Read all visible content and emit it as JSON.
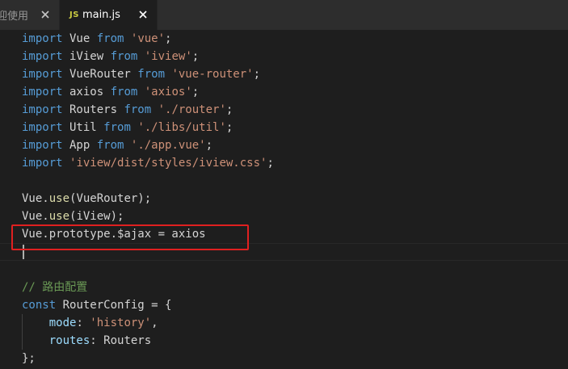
{
  "tabs": [
    {
      "label": "迎使用",
      "active": false
    },
    {
      "label": "main.js",
      "icon": "JS",
      "active": true
    }
  ],
  "code_lines": [
    [
      [
        "kw",
        "import"
      ],
      [
        "id",
        " Vue "
      ],
      [
        "kw",
        "from"
      ],
      [
        "id",
        " "
      ],
      [
        "str",
        "'vue'"
      ],
      [
        "pn",
        ";"
      ]
    ],
    [
      [
        "kw",
        "import"
      ],
      [
        "id",
        " iView "
      ],
      [
        "kw",
        "from"
      ],
      [
        "id",
        " "
      ],
      [
        "str",
        "'iview'"
      ],
      [
        "pn",
        ";"
      ]
    ],
    [
      [
        "kw",
        "import"
      ],
      [
        "id",
        " VueRouter "
      ],
      [
        "kw",
        "from"
      ],
      [
        "id",
        " "
      ],
      [
        "str",
        "'vue-router'"
      ],
      [
        "pn",
        ";"
      ]
    ],
    [
      [
        "kw",
        "import"
      ],
      [
        "id",
        " axios "
      ],
      [
        "kw",
        "from"
      ],
      [
        "id",
        " "
      ],
      [
        "str",
        "'axios'"
      ],
      [
        "pn",
        ";"
      ]
    ],
    [
      [
        "kw",
        "import"
      ],
      [
        "id",
        " Routers "
      ],
      [
        "kw",
        "from"
      ],
      [
        "id",
        " "
      ],
      [
        "str",
        "'./router'"
      ],
      [
        "pn",
        ";"
      ]
    ],
    [
      [
        "kw",
        "import"
      ],
      [
        "id",
        " Util "
      ],
      [
        "kw",
        "from"
      ],
      [
        "id",
        " "
      ],
      [
        "str",
        "'./libs/util'"
      ],
      [
        "pn",
        ";"
      ]
    ],
    [
      [
        "kw",
        "import"
      ],
      [
        "id",
        " App "
      ],
      [
        "kw",
        "from"
      ],
      [
        "id",
        " "
      ],
      [
        "str",
        "'./app.vue'"
      ],
      [
        "pn",
        ";"
      ]
    ],
    [
      [
        "kw",
        "import"
      ],
      [
        "id",
        " "
      ],
      [
        "str",
        "'iview/dist/styles/iview.css'"
      ],
      [
        "pn",
        ";"
      ]
    ],
    [],
    [
      [
        "id",
        "Vue."
      ],
      [
        "fn",
        "use"
      ],
      [
        "pn",
        "(VueRouter);"
      ]
    ],
    [
      [
        "id",
        "Vue."
      ],
      [
        "fn",
        "use"
      ],
      [
        "pn",
        "(iView);"
      ]
    ],
    [
      [
        "id",
        "Vue.prototype.$ajax = axios"
      ]
    ],
    [],
    [],
    [
      [
        "cmt",
        "// 路由配置"
      ]
    ],
    [
      [
        "kw",
        "const"
      ],
      [
        "id",
        " RouterConfig = {"
      ]
    ],
    [
      [
        "id",
        "    "
      ],
      [
        "prop",
        "mode"
      ],
      [
        "pn",
        ": "
      ],
      [
        "str",
        "'history'"
      ],
      [
        "pn",
        ","
      ]
    ],
    [
      [
        "id",
        "    "
      ],
      [
        "prop",
        "routes"
      ],
      [
        "pn",
        ": Routers"
      ]
    ],
    [
      [
        "pn",
        "};"
      ]
    ]
  ],
  "colors": {
    "background": "#1e1e1e",
    "keyword": "#569cd6",
    "string": "#ce9178",
    "function": "#dcdcaa",
    "property": "#9cdcfe",
    "comment": "#6a9955",
    "highlight_box": "#e02020"
  }
}
